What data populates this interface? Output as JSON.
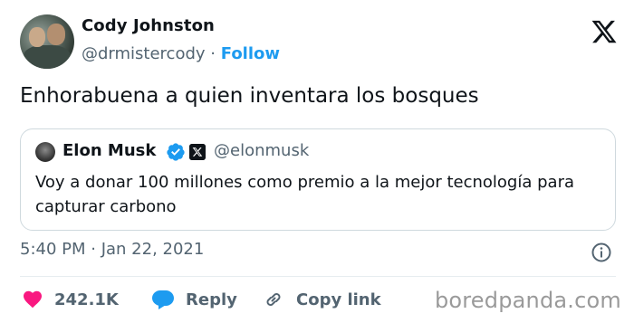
{
  "author": {
    "name": "Cody Johnston",
    "handle": "@drmistercody",
    "separator": "·",
    "follow_label": "Follow"
  },
  "tweet": {
    "text": "Enhorabuena a quien inventara los bosques"
  },
  "quoted_tweet": {
    "name": "Elon Musk",
    "handle": "@elonmusk",
    "text": "Voy a donar 100 millones como premio a la mejor tecnología para capturar carbono"
  },
  "meta": {
    "time": "5:40 PM · Jan 22, 2021"
  },
  "actions": {
    "likes": "242.1K",
    "reply_label": "Reply",
    "copy_label": "Copy link"
  },
  "watermark": "boredpanda.com",
  "colors": {
    "accent": "#1d9bf0",
    "like": "#f91880",
    "text": "#0f1419",
    "muted": "#536471",
    "border": "#cfd9de"
  },
  "icons": {
    "brand": "x-logo-icon",
    "verified": "verified-badge-icon",
    "info": "info-icon",
    "like": "heart-icon",
    "reply": "reply-bubble-icon",
    "copy": "link-icon"
  }
}
